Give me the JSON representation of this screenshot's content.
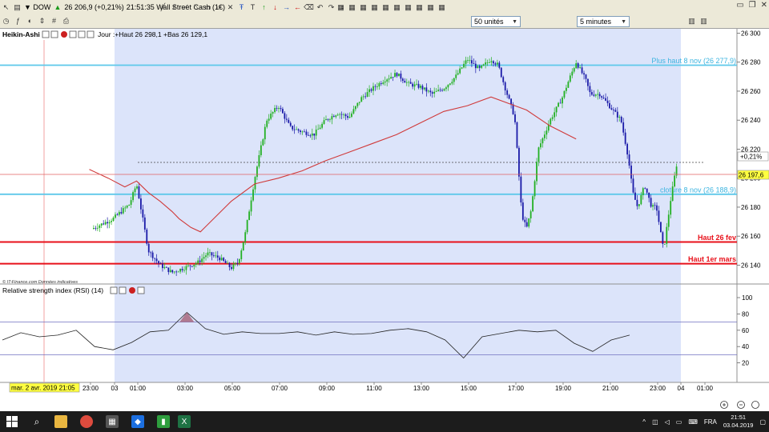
{
  "toolbar": {
    "symbol": "DOW",
    "quote": "26 206,9 (+0,21%)",
    "time_desc": "21:51:35 Wall Street Cash (1€)",
    "units_select": "50 unités",
    "interval_select": "5 minutes"
  },
  "chart_header": {
    "chart_type": "Heikin-Ashi",
    "day_info": "Jour :+Haut 26 298,1 +Bas 26 129,1",
    "watermark": "© IT-Finance.com Données indicatives"
  },
  "price_axis": {
    "ticks": [
      "26 300",
      "26 280",
      "26 260",
      "26 240",
      "26 220",
      "26 200",
      "26 180",
      "26 160",
      "26 140"
    ],
    "change_badge": "+0,21%",
    "price_badge": "26 197,6"
  },
  "levels": [
    {
      "label": "Plus haut 8 nov (26 277,9)",
      "value": 26277.9,
      "color": "#5ec8ea"
    },
    {
      "label": "cloture  8 nov (26 188,9)",
      "value": 26188.9,
      "color": "#5ec8ea"
    },
    {
      "label": "Haut 26 fev",
      "value": 26156,
      "color": "#e8101a"
    },
    {
      "label": "Haut 1er mars",
      "value": 26141,
      "color": "#e8101a"
    }
  ],
  "rsi": {
    "title": "Relative strength index (RSI) (14)",
    "ticks": [
      "100",
      "80",
      "60",
      "40",
      "20"
    ],
    "overbought": 70,
    "oversold": 30
  },
  "time_axis": {
    "start_label": "mar. 2 avr. 2019 21:05",
    "labels": [
      "23:00",
      "03",
      "01:00",
      "03:00",
      "05:00",
      "07:00",
      "09:00",
      "11:00",
      "13:00",
      "15:00",
      "17:00",
      "19:00",
      "21:00",
      "23:00",
      "04",
      "01:00"
    ]
  },
  "chart_data": {
    "type": "line",
    "title": "",
    "xlabel": "",
    "ylabel": "",
    "ylim": [
      26127,
      26303
    ],
    "x": [
      -2.9,
      -2,
      -1.3,
      -1,
      -0.5,
      0,
      0.5,
      1,
      1.6,
      2,
      2.5,
      3,
      3.3,
      3.6,
      4,
      4.5,
      5,
      5.5,
      6,
      6.5,
      7,
      7.5,
      8,
      8.5,
      9,
      9.5,
      10,
      10.5,
      11,
      11.5,
      12,
      12.5,
      13,
      13.5,
      14,
      14.3,
      14.6,
      15,
      15.3,
      15.5,
      15.7,
      16,
      16.5,
      17,
      17.3,
      17.6,
      18,
      18.2,
      18.6,
      19,
      19.5,
      19.8,
      20,
      20.2,
      20.5,
      20.8,
      21,
      21.3,
      21.6,
      21.86
    ],
    "series": [
      {
        "values": [
          26165,
          26172,
          26182,
          26196,
          26150,
          26140,
          26135,
          26138,
          26142,
          26148,
          26145,
          26138,
          26142,
          26162,
          26200,
          26240,
          26250,
          26235,
          26232,
          26230,
          26240,
          26245,
          26242,
          26255,
          26262,
          26268,
          26272,
          26265,
          26263,
          26258,
          26262,
          26270,
          26282,
          26275,
          26282,
          26278,
          26262,
          26242,
          26175,
          26165,
          26178,
          26220,
          26240,
          26255,
          26268,
          26280,
          26268,
          26258,
          26258,
          26250,
          26240,
          26215,
          26190,
          26180,
          26195,
          26180,
          26180,
          26150,
          26185,
          26210
        ]
      },
      {
        "name": "MM",
        "values": [
          26206,
          26200,
          26194,
          26198,
          26190,
          26184,
          26177,
          26172,
          26166,
          26163,
          26184,
          26196,
          26200,
          26205,
          26212,
          26218,
          26224,
          26230,
          26238,
          26246,
          26250,
          26256,
          26247,
          26236,
          26227
        ]
      }
    ],
    "rsi_values": [
      48,
      57,
      52,
      54,
      60,
      40,
      36,
      45,
      58,
      60,
      82,
      62,
      55,
      58,
      56,
      56,
      58,
      54,
      58,
      55,
      56,
      60,
      62,
      58,
      48,
      26,
      52,
      56,
      60,
      58,
      60,
      44,
      34,
      48,
      54
    ]
  }
}
